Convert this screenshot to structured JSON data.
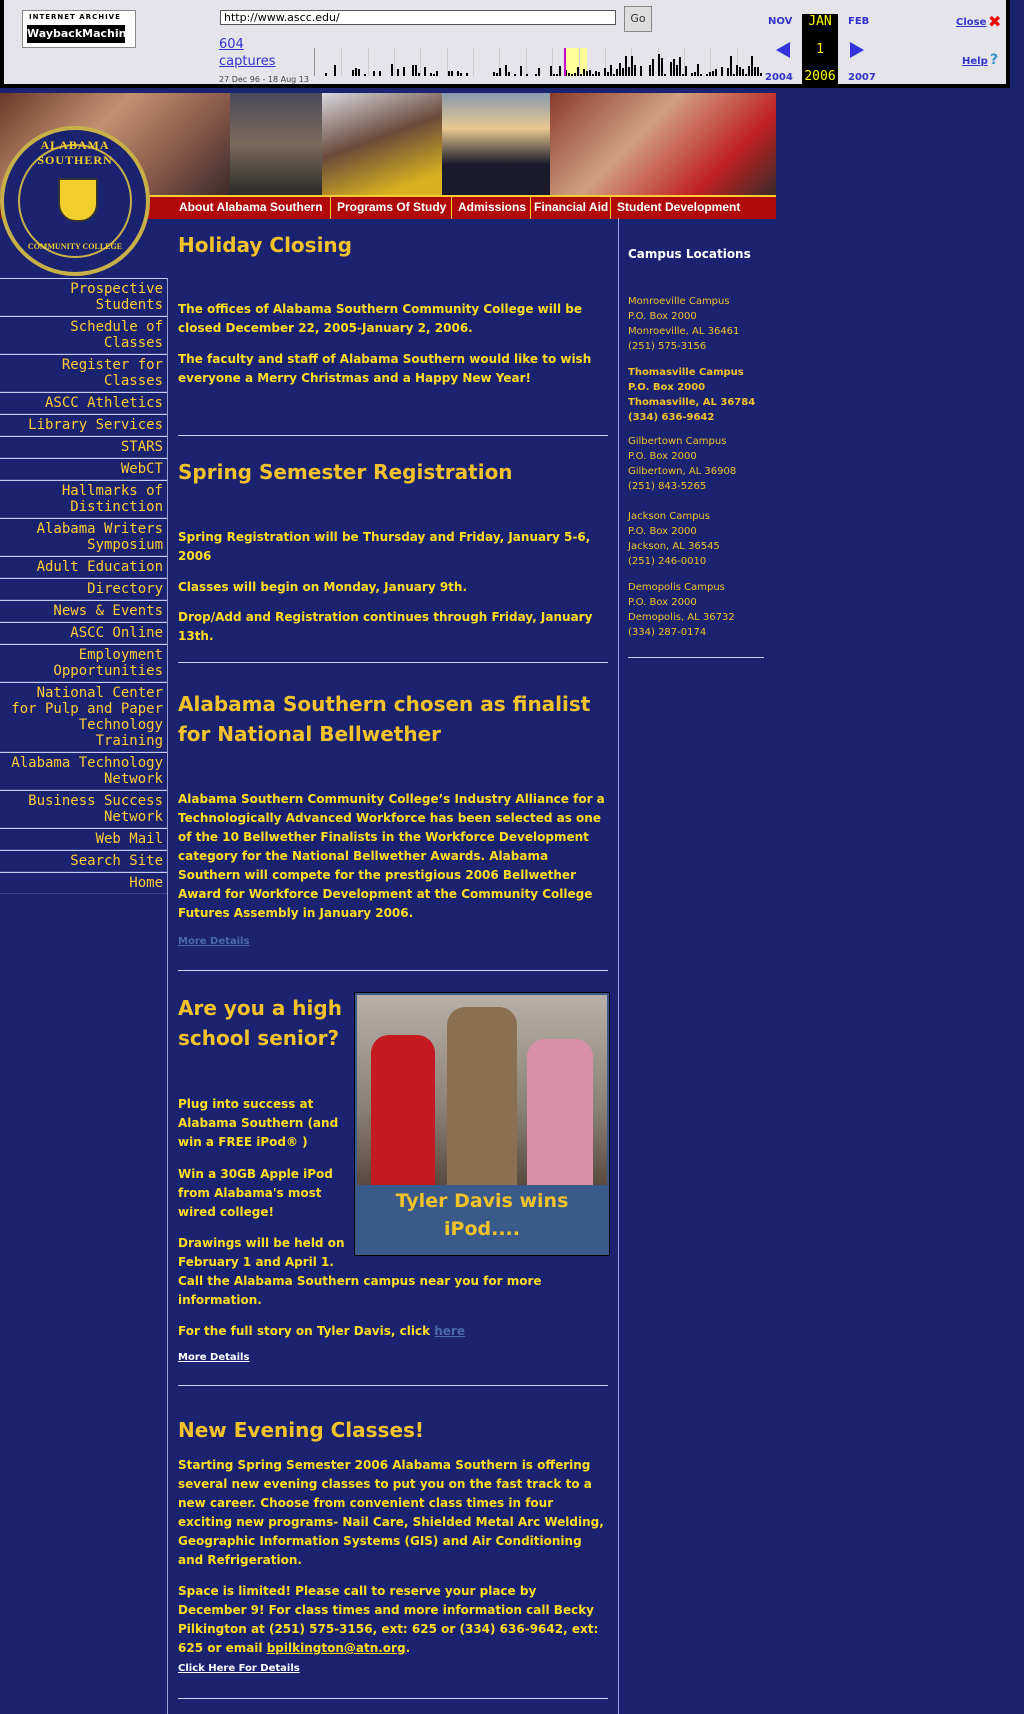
{
  "wayback": {
    "logo_top": "INTERNET ARCHIVE",
    "logo_main": "WaybackMachine",
    "url": "http://www.ascc.edu/",
    "go_label": "Go",
    "captures_count": "604",
    "captures_label": "captures",
    "date_range": "27 Dec 96 - 18 Aug 13",
    "prev_month": "NOV",
    "cur_month": "JAN",
    "next_month": "FEB",
    "cur_day": "1",
    "prev_year": "2004",
    "cur_year": "2006",
    "next_year": "2007",
    "close_label": "Close",
    "help_label": "Help"
  },
  "header": {
    "seal_top": "ALABAMA SOUTHERN",
    "seal_bottom": "COMMUNITY COLLEGE",
    "nav": [
      "About Alabama Southern",
      "Programs Of Study",
      "Admissions",
      "Financial Aid",
      "Student Development"
    ]
  },
  "sidebar": {
    "items": [
      "Prospective Students",
      "Schedule of Classes",
      "Register for Classes",
      "ASCC Athletics",
      "Library Services",
      "STARS",
      "WebCT",
      "Hallmarks of Distinction",
      "Alabama Writers Symposium",
      "Adult Education",
      "Directory",
      "News & Events",
      "ASCC Online",
      "Employment Opportunities",
      "National Center for Pulp and Paper Technology Training",
      "Alabama Technology Network",
      "Business Success Network",
      "Web Mail",
      "Search Site",
      "Home"
    ]
  },
  "news": {
    "holiday": {
      "title": "Holiday Closing",
      "p1": "The offices of Alabama Southern Community College will be closed December 22, 2005-January 2, 2006.",
      "p2": "The faculty and staff of Alabama Southern would like to wish everyone a Merry Christmas and a Happy New Year!"
    },
    "spring": {
      "title": "Spring Semester Registration",
      "p1": "Spring Registration will be Thursday and Friday, January 5-6, 2006",
      "p2": "Classes will begin on Monday, January 9th.",
      "p3": "Drop/Add and Registration continues through Friday, January 13th."
    },
    "bellwether": {
      "title": "Alabama Southern chosen as finalist for National Bellwether",
      "p1": "Alabama Southern Community College’s Industry Alliance for a Technologically Advanced Workforce has been selected as one of the 10 Bellwether Finalists in the Workforce Development category for the National Bellwether Awards. Alabama Southern will compete for the prestigious 2006 Bellwether Award for Workforce Development at the Community College Futures Assembly in January 2006.",
      "more": "More Details"
    },
    "senior": {
      "title": "Are you a high school senior?",
      "p1": "Plug into success at Alabama Southern (and win a FREE iPod® )",
      "p2": "Win a 30GB Apple iPod from Alabama's most wired college!",
      "p3a": "Drawings will be held on February 1 and April 1.",
      "p3b": "Call the Alabama Southern campus near you for more information.",
      "p4": "For the full story on Tyler Davis, click ",
      "p4_link": "here",
      "more": "More Details",
      "photo_caption": "Tyler Davis wins iPod...."
    },
    "evening": {
      "title": "New Evening Classes!",
      "p1": "Starting Spring Semester 2006 Alabama Southern is offering several new evening classes to put you on the fast track to a new career. Choose from convenient class times in four exciting new programs- Nail Care, Shielded Metal Arc Welding, Geographic Information Systems (GIS) and Air Conditioning and Refrigeration.",
      "p2": "Space is limited! Please call to reserve your place by December 9! For class times and more information call Becky Pilkington at (251) 575-3156, ext: 625 or (334) 636-9642, ext: 625 or email ",
      "email": "bpilkington@atn.org",
      "p2_end": ".",
      "more": "Click Here For Details"
    }
  },
  "campuses": {
    "title": "Campus Locations",
    "list": [
      {
        "name": "Monroeville Campus",
        "box": "P.O. Box 2000",
        "city": "Monroeville, AL 36461",
        "phone": "(251) 575-3156"
      },
      {
        "name": "Thomasville Campus",
        "box": "P.O. Box 2000",
        "city": "Thomasville, AL 36784",
        "phone": "(334) 636-9642"
      },
      {
        "name": "Gilbertown Campus",
        "box": "P.O. Box 2000",
        "city": "Gilbertown, AL 36908",
        "phone": "(251) 843-5265"
      },
      {
        "name": "Jackson Campus",
        "box": "P.O. Box 2000",
        "city": "Jackson, AL 36545",
        "phone": "(251) 246-0010"
      },
      {
        "name": "Demopolis Campus",
        "box": "P.O. Box 2000",
        "city": "Demopolis, AL 36732",
        "phone": "(334) 287-0174"
      }
    ]
  },
  "colors": {
    "background": "#1b2270",
    "text": "#ffdd22",
    "heading": "#f2c22a",
    "nav_red": "#b00a0a"
  }
}
